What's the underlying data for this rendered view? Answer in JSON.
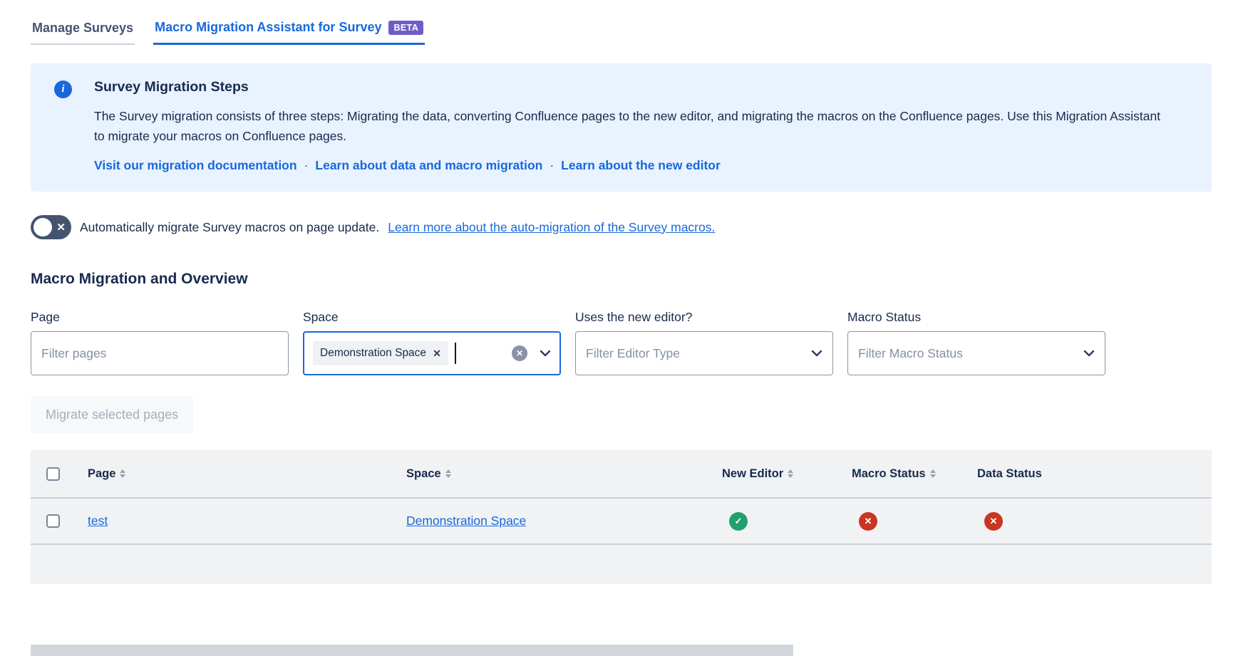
{
  "tabs": {
    "manage_label": "Manage Surveys",
    "assistant_label": "Macro Migration Assistant for Survey",
    "beta_label": "BETA"
  },
  "info_panel": {
    "title": "Survey Migration Steps",
    "body": "The Survey migration consists of three steps: Migrating the data, converting Confluence pages to the new editor, and migrating the macros on the Confluence pages. Use this Migration Assistant to migrate your macros on Confluence pages.",
    "separator": "·",
    "links": [
      "Visit our migration documentation",
      "Learn about data and macro migration",
      "Learn about the new editor"
    ]
  },
  "auto_migration": {
    "text": "Automatically migrate Survey macros on page update.",
    "link": "Learn more about the auto-migration of the Survey macros."
  },
  "section": {
    "title": "Macro Migration and Overview"
  },
  "filters": {
    "page": {
      "label": "Page",
      "placeholder": "Filter pages"
    },
    "space": {
      "label": "Space",
      "selected_chip": "Demonstration Space"
    },
    "editor": {
      "label": "Uses the new editor?",
      "placeholder": "Filter Editor Type"
    },
    "macro_status": {
      "label": "Macro Status",
      "placeholder": "Filter Macro Status"
    }
  },
  "migrate_button_label": "Migrate selected pages",
  "table": {
    "headers": {
      "page": "Page",
      "space": "Space",
      "new_editor": "New Editor",
      "macro_status": "Macro Status",
      "data_status": "Data Status"
    },
    "rows": [
      {
        "page": "test",
        "space": "Demonstration Space",
        "new_editor": "success",
        "macro_status": "error",
        "data_status": "error"
      }
    ]
  },
  "icons": {
    "info": "i",
    "check": "✓",
    "cross": "✕"
  },
  "colors": {
    "accent_blue": "#1868DB",
    "beta_purple": "#6E5DC6",
    "info_bg": "#E9F2FF",
    "toggle_bg": "#44546F",
    "success_green": "#22A06B",
    "error_red": "#CA3521"
  }
}
